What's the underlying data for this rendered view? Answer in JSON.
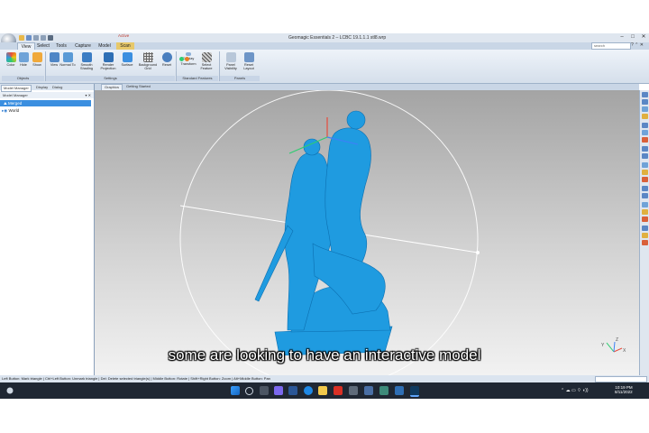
{
  "window": {
    "title": "Geomagic Essentials 2 – LCBC 19.1.1.1 stl8.wrp",
    "context_tab": "Active",
    "controls": [
      "–",
      "□",
      "✕"
    ]
  },
  "ribbon": {
    "tabs": [
      "View",
      "Select",
      "Tools",
      "Capture",
      "Model",
      "Scan"
    ],
    "active_tab": "View",
    "search_placeholder": "search",
    "groups": [
      {
        "label": "Objects",
        "buttons": [
          "Color",
          "Hide",
          "Show"
        ]
      },
      {
        "label": "Settings",
        "buttons": [
          "View",
          "Normal To",
          "Smooth Shading",
          "Render Projection",
          "Surface",
          "Background Grid",
          "Reset"
        ]
      },
      {
        "label": "Standard Features",
        "buttons": [
          "Display",
          "Transform",
          "Select Feature"
        ]
      },
      {
        "label": "Panels",
        "buttons": [
          "Panel Visibility",
          "Reset Layout"
        ]
      }
    ]
  },
  "panel": {
    "tabs": [
      "Model Manager",
      "Display",
      "Dialog"
    ],
    "active_tab": "Model Manager",
    "header": "Model Manager",
    "tree": [
      {
        "label": "Merged",
        "selected": true
      },
      {
        "label": "World",
        "selected": false
      }
    ]
  },
  "viewport": {
    "tabs": [
      "Graphics",
      "Getting Started"
    ],
    "active_tab": "Graphics",
    "model_color": "#1f9be0",
    "axis_labels": [
      "Y",
      "X",
      "Z"
    ]
  },
  "subtitle": "some are looking to have an interactive model",
  "statusbar": {
    "text": "Left Button: Mark triangle | Ctrl+Left Button: Unmark triangle | Del: Delete selected triangle(s) | Middle Button: Rotate | Shift+Right Button: Zoom | Alt+Middle Button: Pan"
  },
  "taskbar": {
    "time": "10:19 PM",
    "date": "8/11/2022"
  },
  "colors": {
    "accent": "#3b8fe0",
    "model": "#1f9be0",
    "taskbar": "#1f2733"
  }
}
